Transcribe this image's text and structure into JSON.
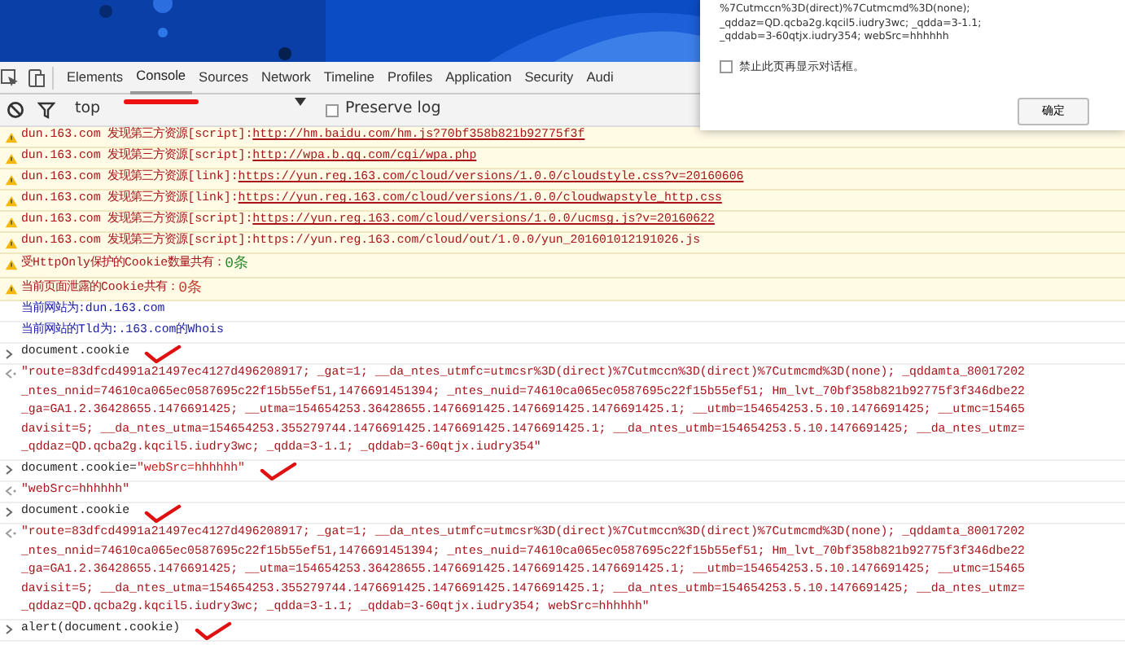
{
  "dialog": {
    "lines": [
      "%7Cutmccn%3D(direct)%7Cutmcmd%3D(none);",
      "_qddaz=QD.qcba2g.kqcil5.iudry3wc; _qdda=3-1.1;",
      "_qddab=3-60qtjx.iudry354; webSrc=hhhhhh"
    ],
    "checkbox": {
      "label": "禁止此页再显示对话框。",
      "checked": false
    },
    "button": "确定"
  },
  "tabs": [
    {
      "label": "Elements",
      "selected": false,
      "annotated": false
    },
    {
      "label": "Console",
      "selected": true,
      "annotated": true
    },
    {
      "label": "Sources",
      "selected": false,
      "annotated": false
    },
    {
      "label": "Network",
      "selected": false,
      "annotated": false
    },
    {
      "label": "Timeline",
      "selected": false,
      "annotated": false
    },
    {
      "label": "Profiles",
      "selected": false,
      "annotated": false
    },
    {
      "label": "Application",
      "selected": false,
      "annotated": false
    },
    {
      "label": "Security",
      "selected": false,
      "annotated": false
    },
    {
      "label": "Audi",
      "selected": false,
      "annotated": false
    }
  ],
  "filter_bar": {
    "context": "top",
    "preserve_log": {
      "label": "Preserve log",
      "checked": false
    }
  },
  "messages": [
    {
      "kind": "warn",
      "text": "dun.163.com 发现第三方资源[script]:",
      "link": "http://hm.baidu.com/hm.js?70bf358b821b92775f3f",
      "underlined": true
    },
    {
      "kind": "warn",
      "text": "dun.163.com 发现第三方资源[script]:",
      "link": "http://wpa.b.qq.com/cgi/wpa.php",
      "underlined": true
    },
    {
      "kind": "warn",
      "text": "dun.163.com 发现第三方资源[link]:",
      "link": "https://yun.reg.163.com/cloud/versions/1.0.0/cloudstyle.css?v=20160606",
      "underlined": true
    },
    {
      "kind": "warn",
      "text": "dun.163.com 发现第三方资源[link]:",
      "link": "https://yun.reg.163.com/cloud/versions/1.0.0/cloudwapstyle_http.css",
      "underlined": true
    },
    {
      "kind": "warn",
      "text": "dun.163.com 发现第三方资源[script]:",
      "link": "https://yun.reg.163.com/cloud/versions/1.0.0/ucmsg.js?v=20160622",
      "underlined": true
    },
    {
      "kind": "warn",
      "text": "dun.163.com 发现第三方资源[script]:",
      "link": "https://yun.reg.163.com/cloud/out/1.0.0/yun_201601012191026.js",
      "underlined": false
    },
    {
      "kind": "warn",
      "text": "受HttpOnly保护的Cookie数量共有：",
      "count": "0条",
      "color": "#2e8b2e"
    },
    {
      "kind": "warn",
      "text": "当前页面泄露的Cookie共有：",
      "count": "0条",
      "color": "#c0392b"
    },
    {
      "kind": "log",
      "text": "当前网站为:dun.163.com"
    },
    {
      "kind": "log",
      "text": "当前网站的Tld为:.163.com的Whois"
    },
    {
      "kind": "input",
      "code": "document.cookie",
      "marked": true
    },
    {
      "kind": "result",
      "lines": [
        "\"route=83dfcd4991a21497ec4127d496208917; _gat=1; __da_ntes_utmfc=utmcsr%3D(direct)%7Cutmccn%3D(direct)%7Cutmcmd%3D(none); _qddamta_80017202",
        "_ntes_nnid=74610ca065ec0587695c22f15b55ef51,1476691451394; _ntes_nuid=74610ca065ec0587695c22f15b55ef51; Hm_lvt_70bf358b821b92775f3f346dbe22",
        "_ga=GA1.2.36428655.1476691425; __utma=154654253.36428655.1476691425.1476691425.1476691425.1; __utmb=154654253.5.10.1476691425; __utmc=15465",
        "davisit=5; __da_ntes_utma=154654253.355279744.1476691425.1476691425.1476691425.1; __da_ntes_utmb=154654253.5.10.1476691425; __da_ntes_utmz=",
        "_qddaz=QD.qcba2g.kqcil5.iudry3wc; _qdda=3-1.1; _qddab=3-60qtjx.iudry354\""
      ]
    },
    {
      "kind": "input",
      "code": "document.cookie=",
      "string": "\"webSrc=hhhhhh\"",
      "marked": true
    },
    {
      "kind": "result",
      "lines": [
        "\"webSrc=hhhhhh\""
      ]
    },
    {
      "kind": "input",
      "code": "document.cookie",
      "marked": true
    },
    {
      "kind": "result",
      "lines": [
        "\"route=83dfcd4991a21497ec4127d496208917; _gat=1; __da_ntes_utmfc=utmcsr%3D(direct)%7Cutmccn%3D(direct)%7Cutmcmd%3D(none); _qddamta_80017202",
        "_ntes_nnid=74610ca065ec0587695c22f15b55ef51,1476691451394; _ntes_nuid=74610ca065ec0587695c22f15b55ef51; Hm_lvt_70bf358b821b92775f3f346dbe22",
        "_ga=GA1.2.36428655.1476691425; __utma=154654253.36428655.1476691425.1476691425.1476691425.1; __utmb=154654253.5.10.1476691425; __utmc=15465",
        "davisit=5; __da_ntes_utma=154654253.355279744.1476691425.1476691425.1476691425.1; __da_ntes_utmb=154654253.5.10.1476691425; __da_ntes_utmz=",
        "_qddaz=QD.qcba2g.kqcil5.iudry3wc; _qdda=3-1.1; _qddab=3-60qtjx.iudry354; webSrc=hhhhhh\""
      ]
    },
    {
      "kind": "input",
      "code": "alert(document.cookie)",
      "marked": true
    }
  ]
}
